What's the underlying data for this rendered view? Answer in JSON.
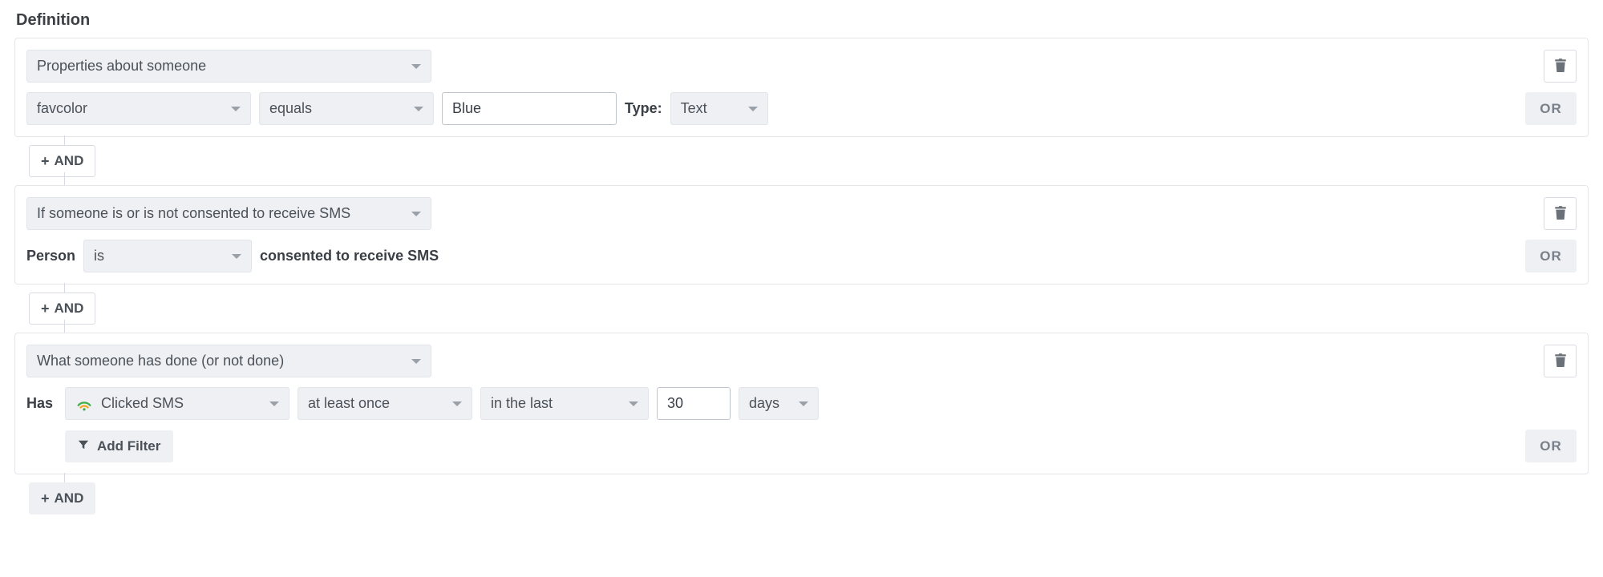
{
  "title": "Definition",
  "buttons": {
    "and": "AND",
    "or": "OR",
    "addFilter": "Add Filter"
  },
  "labels": {
    "type": "Type:",
    "person": "Person",
    "consentSuffix": "consented to receive SMS",
    "has": "Has"
  },
  "groups": [
    {
      "conditionType": "Properties about someone",
      "property": "favcolor",
      "operator": "equals",
      "value": "Blue",
      "valueType": "Text"
    },
    {
      "conditionType": "If someone is or is not consented to receive SMS",
      "isOrIsNot": "is"
    },
    {
      "conditionType": "What someone has done (or not done)",
      "event": "Clicked SMS",
      "frequency": "at least once",
      "timeframe": "in the last",
      "number": "30",
      "unit": "days"
    }
  ]
}
